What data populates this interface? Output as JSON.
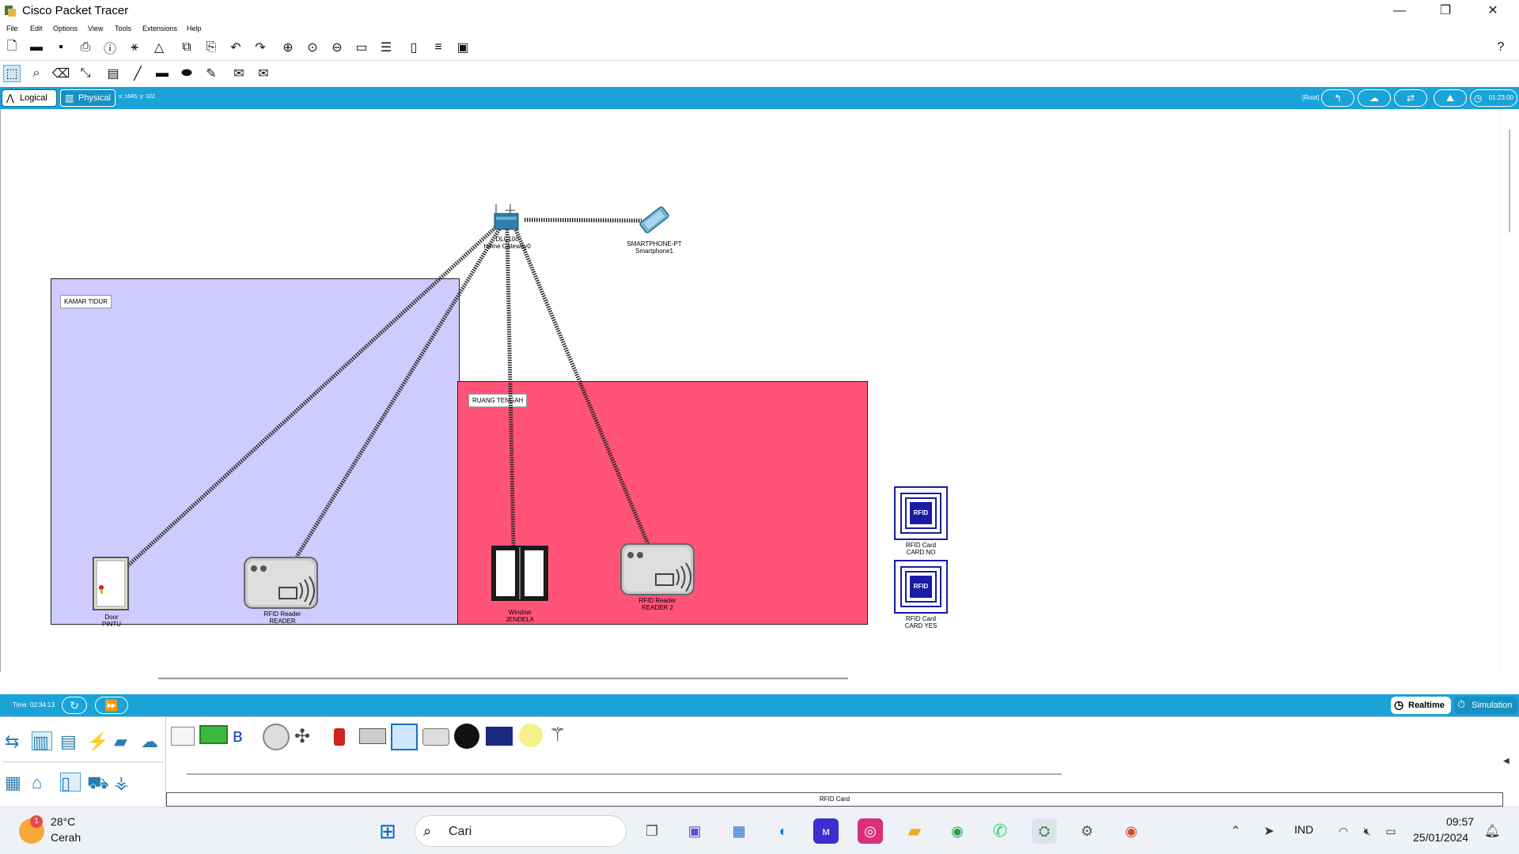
{
  "window": {
    "title": "Cisco Packet Tracer",
    "minimize": "—",
    "maximize": "❐",
    "close": "✕"
  },
  "menu": [
    "File",
    "Edit",
    "Options",
    "View",
    "Tools",
    "Extensions",
    "Help"
  ],
  "band": {
    "logical": "Logical",
    "physical": "Physical",
    "coords": "x: 1645, y: 322",
    "root": "[Root]",
    "clock": "01:23:00"
  },
  "workspace": {
    "rooms": [
      {
        "label": "KAMAR TIDUR",
        "color": "#cfcbff"
      },
      {
        "label": "RUANG TENGAH",
        "color": "#ff5478"
      }
    ],
    "devices": {
      "gateway": {
        "line1": "DLC100",
        "line2": "Home Gateway0"
      },
      "smartphone": {
        "line1": "SMARTPHONE-PT",
        "line2": "Smartphone1"
      },
      "door": {
        "line1": "Door",
        "line2": "PINTU"
      },
      "reader1": {
        "line1": "RFID Reader",
        "line2": "READER"
      },
      "window": {
        "line1": "Window",
        "line2": "JENDELA"
      },
      "reader2": {
        "line1": "RFID Reader",
        "line2": "READER 2"
      },
      "card1": {
        "line1": "RFID Card",
        "line2": "CARD NO",
        "badge": "RFID"
      },
      "card2": {
        "line1": "RFID Card",
        "line2": "CARD YES",
        "badge": "RFID"
      }
    }
  },
  "bottom": {
    "time": "Time: 02:34:13",
    "realtime": "Realtime",
    "simulation": "Simulation",
    "selected_device": "RFID Card"
  },
  "taskbar": {
    "weather_temp": "28°C",
    "weather_desc": "Cerah",
    "weather_badge": "1",
    "search": "Cari",
    "lang": "IND",
    "time": "09:57",
    "date": "25/01/2024"
  },
  "colors": {
    "accent": "#1aa3d9",
    "room1": "#cfcbff",
    "room2": "#ff5478",
    "rfid_blue": "#1a1aa6"
  }
}
